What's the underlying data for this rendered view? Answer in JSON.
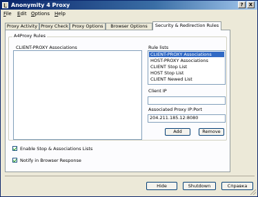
{
  "window": {
    "title": "Anonymity 4 Proxy",
    "min_label": "?",
    "close_label": "X"
  },
  "menu": {
    "file_mnemonic": "F",
    "file_rest": "ile",
    "edit_mnemonic": "E",
    "edit_rest": "dit",
    "options_mnemonic": "O",
    "options_rest": "ptions",
    "help_mnemonic": "H",
    "help_rest": "elp"
  },
  "tabs": [
    {
      "label": "Proxy Activity"
    },
    {
      "label": "Proxy Check"
    },
    {
      "label": "Proxy Options"
    },
    {
      "label": "Browser Options"
    },
    {
      "label": "Security & Redirection Rules"
    }
  ],
  "group": {
    "title": "A4Proxy Rules",
    "associations_label": "CLIENT-PROXY Associations",
    "rule_lists_label": "Rule lists",
    "rule_lists": [
      "CLIENT-PROXY Associations",
      "HOST-PROXY Associations",
      "CLIENT Stop List",
      "HOST Stop List",
      "CLIENT Newed List"
    ],
    "client_ip_label": "Client IP",
    "client_ip_value": "",
    "proxy_label": "Associated Proxy IP:Port",
    "proxy_value": "204.211.185.12:8080",
    "add_label": "Add",
    "remove_label": "Remove"
  },
  "options": {
    "enable_stop_label": "Enable Stop & Associations Lists",
    "notify_label": "Notify in Browser Response"
  },
  "footer": {
    "hide_label": "Hide",
    "shutdown_label": "Shutdown",
    "help_label": "Справка"
  }
}
